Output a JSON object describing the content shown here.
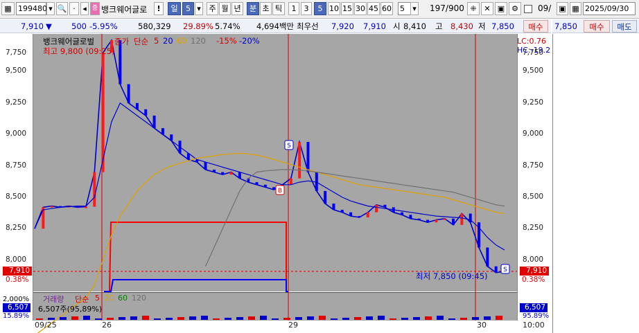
{
  "toolbar": {
    "stock_code": "199480",
    "stock_name": "뱅크웨어글로",
    "info_mark": "!",
    "period_day": "일",
    "period_count": "5",
    "periods": [
      "주",
      "월",
      "년",
      "분",
      "초",
      "틱"
    ],
    "minutes": [
      "1",
      "3",
      "5",
      "10",
      "15",
      "30",
      "45",
      "60"
    ],
    "bar_count": "5",
    "page": "197/900",
    "date_field": "2025/09/30",
    "right_date_stub": "09/"
  },
  "pricebar": {
    "price": "7,910",
    "change": "500",
    "change_pct": "-5.95%",
    "volume": "580,329",
    "turnover_pct": "29.89%",
    "ratio": "5.74%",
    "amount": "4,694백만",
    "best_bid_label": "최우선",
    "bid": "7,920",
    "ask": "7,910",
    "open_label": "시",
    "open": "8,410",
    "high_label": "고",
    "high": "8,430",
    "low_label": "저",
    "low": "7,850",
    "buy_button": "매수",
    "right_price": "7,850",
    "right_buy": "매수",
    "right_sell": "매도"
  },
  "chart_title": {
    "name": "뱅크웨어글로벌",
    "legend_close": "종가",
    "legend_ma": "단순",
    "ma_periods": [
      "5",
      "20",
      "60",
      "120"
    ],
    "band_up": "-15%",
    "band_down": "-20%",
    "high_note": "최고 9,800 (09:25)",
    "low_note": "최저 7,850 (09:45)",
    "lc": "LC:0.76",
    "hc": "HC:-19.2",
    "price_marker": "7,910",
    "pct_marker": "0.38%",
    "signal_s": "S",
    "signal_b": "B"
  },
  "volume_panel": {
    "title": "거래량",
    "ma_label": "단순",
    "ma_periods": [
      "5",
      "20",
      "60",
      "120"
    ],
    "volume_text": "6,507주(95,89%)",
    "left_top": "2,000%",
    "left_val": "6,507",
    "left_pct": "15.89%",
    "right_val": "6,507",
    "right_pct": "95.89%"
  },
  "chart_data": {
    "type": "line",
    "title": "뱅크웨어글로벌",
    "ylim": [
      7750,
      9800
    ],
    "yticks": [
      "7,750",
      "8,000",
      "8,250",
      "8,500",
      "8,750",
      "9,000",
      "9,250",
      "9,500",
      "7,750"
    ],
    "x_labels": [
      "09/25",
      "26",
      "29",
      "30",
      "10:00"
    ],
    "series": [
      {
        "name": "종가",
        "color": "#0000c8",
        "values": [
          8250,
          8420,
          8430,
          8420,
          8430,
          8420,
          8425,
          8700,
          9650,
          9750,
          9400,
          9250,
          9200,
          9150,
          9050,
          9000,
          8950,
          8850,
          8800,
          8780,
          8720,
          8700,
          8680,
          8700,
          8650,
          8620,
          8600,
          8580,
          8560,
          8600,
          8650,
          8940,
          8700,
          8550,
          8450,
          8400,
          8380,
          8350,
          8340,
          8380,
          8440,
          8420,
          8380,
          8360,
          8330,
          8320,
          8300,
          8320,
          8330,
          8280,
          8370,
          8300,
          8100,
          7950,
          7900,
          7910
        ]
      },
      {
        "name": "20",
        "color": "#0000c8",
        "values": [
          8250,
          8400,
          8410,
          8420,
          8425,
          8430,
          8430,
          8500,
          8800,
          9100,
          9250,
          9200,
          9150,
          9100,
          9050,
          9000,
          8950,
          8900,
          8850,
          8800,
          8780,
          8760,
          8740,
          8720,
          8700,
          8680,
          8660,
          8640,
          8620,
          8600,
          8600,
          8620,
          8630,
          8620,
          8580,
          8540,
          8500,
          8470,
          8450,
          8430,
          8420,
          8410,
          8400,
          8390,
          8380,
          8370,
          8360,
          8350,
          8345,
          8340,
          8335,
          8320,
          8260,
          8180,
          8120,
          8080
        ]
      },
      {
        "name": "60",
        "color": "#e0a000",
        "values": [
          7400,
          7450,
          7500,
          7550,
          7600,
          7650,
          7700,
          7800,
          8000,
          8200,
          8350,
          8450,
          8550,
          8620,
          8680,
          8720,
          8750,
          8770,
          8790,
          8810,
          8820,
          8830,
          8840,
          8845,
          8850,
          8845,
          8835,
          8820,
          8800,
          8780,
          8760,
          8740,
          8720,
          8700,
          8680,
          8660,
          8640,
          8620,
          8600,
          8590,
          8580,
          8570,
          8560,
          8550,
          8540,
          8530,
          8520,
          8510,
          8500,
          8480,
          8460,
          8440,
          8420,
          8400,
          8380,
          8370
        ]
      },
      {
        "name": "120",
        "color": "#707070",
        "values": [
          null,
          null,
          null,
          null,
          null,
          null,
          null,
          null,
          null,
          null,
          null,
          null,
          null,
          null,
          null,
          null,
          null,
          null,
          null,
          null,
          7950,
          8100,
          8250,
          8400,
          8550,
          8650,
          8700,
          8710,
          8715,
          8720,
          8720,
          8715,
          8710,
          8700,
          8690,
          8680,
          8670,
          8660,
          8650,
          8640,
          8630,
          8620,
          8610,
          8600,
          8590,
          8580,
          8570,
          8560,
          8550,
          8540,
          8520,
          8500,
          8480,
          8460,
          8440,
          8430
        ]
      }
    ]
  }
}
